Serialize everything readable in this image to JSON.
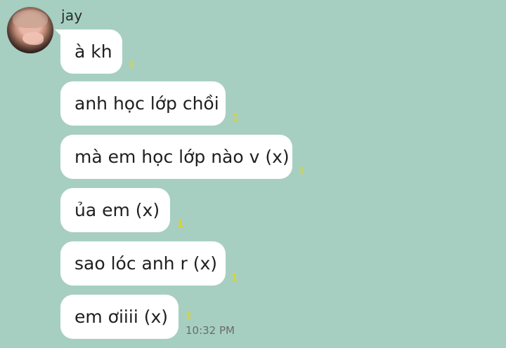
{
  "chat": {
    "sender": "jay",
    "messages": [
      {
        "text": "à kh",
        "read": "1"
      },
      {
        "text": "anh học lớp chồi",
        "read": "1"
      },
      {
        "text": "mà em học lớp nào v (x)",
        "read": "1"
      },
      {
        "text": "ủa em (x)",
        "read": "1"
      },
      {
        "text": "sao lóc anh r (x)",
        "read": "1"
      },
      {
        "text": "em ơiiii (x)",
        "read": "1"
      }
    ],
    "last_time": "10:32 PM"
  },
  "colors": {
    "background": "#a6cfc2",
    "bubble": "#ffffff",
    "read_marker": "#d9d239"
  }
}
